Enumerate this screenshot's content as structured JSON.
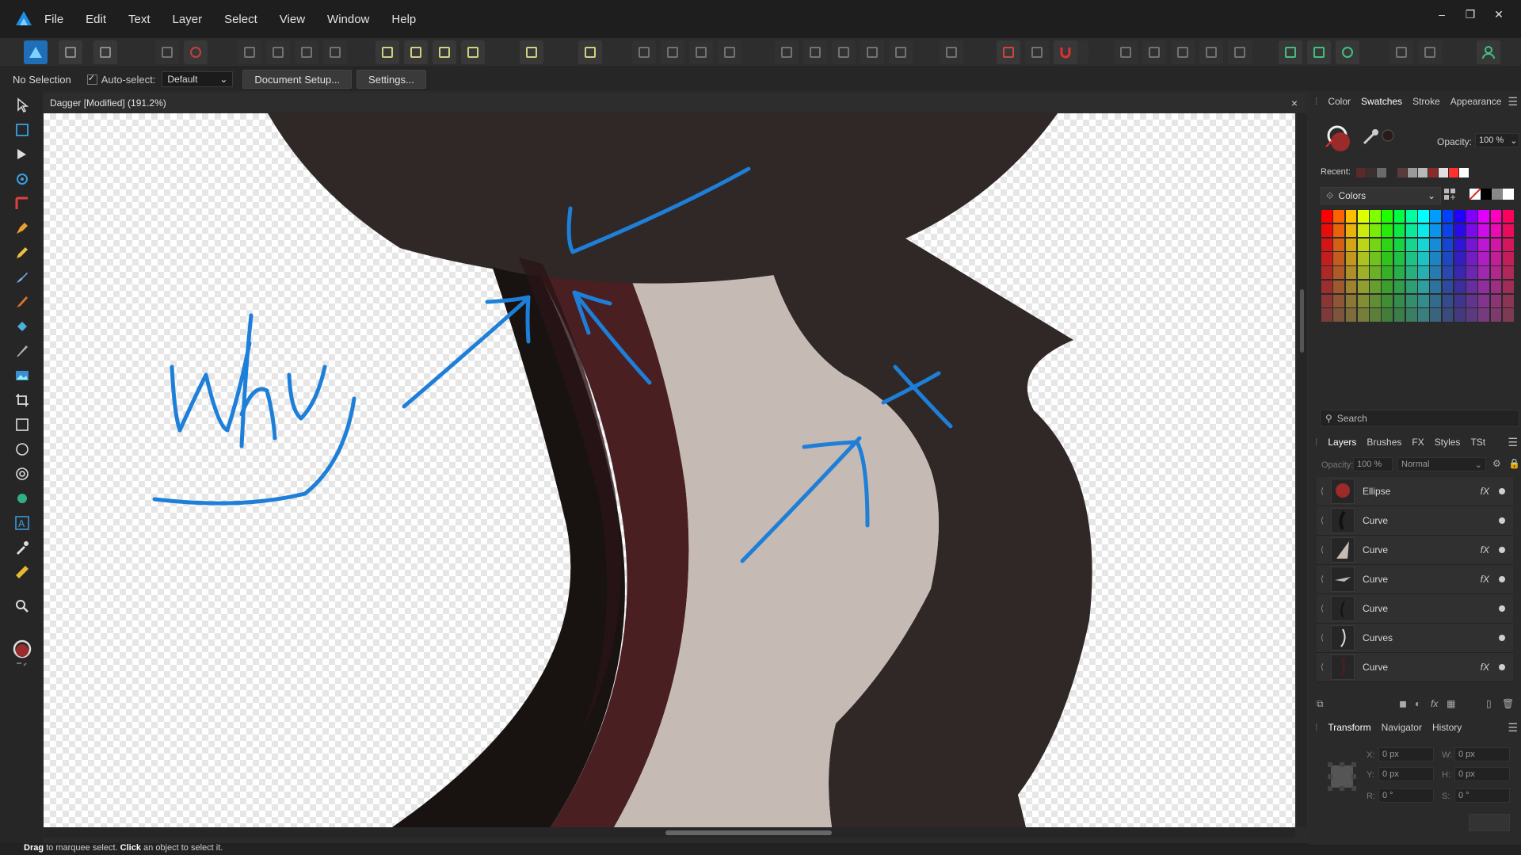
{
  "menu": [
    "File",
    "Edit",
    "Text",
    "Layer",
    "Select",
    "View",
    "Window",
    "Help"
  ],
  "window_controls": {
    "minimize": "–",
    "restore": "❐",
    "close": "✕"
  },
  "context": {
    "selection": "No Selection",
    "auto_select_label": "Auto-select:",
    "auto_select_value": "Default",
    "document_setup": "Document Setup...",
    "settings": "Settings..."
  },
  "document": {
    "title": "Dagger [Modified] (191.2%)",
    "close": "×"
  },
  "annotation_text": "why",
  "status": {
    "drag": "Drag",
    "drag_rest": " to marquee select. ",
    "click": "Click",
    "click_rest": " an object to select it."
  },
  "color_panel": {
    "tabs": [
      "Color",
      "Swatches",
      "Stroke",
      "Appearance"
    ],
    "active_tab": "Swatches",
    "opacity_label": "Opacity:",
    "opacity_value": "100 %",
    "recent_label": "Recent:",
    "palette": "Colors",
    "search_placeholder": "Search",
    "fill_color": "#9b2a2a",
    "recent_colors": [
      "#5a2a2a",
      "#3a3030",
      "#6a6a6a",
      "#2a2a2a",
      "#5a3a3a",
      "#9a9a9a",
      "#b8b8b8",
      "#8a2a2a",
      "#e0e0e0",
      "#ff3030",
      "#ffffff"
    ]
  },
  "layers_panel": {
    "tabs": [
      "Layers",
      "Brushes",
      "FX",
      "Styles",
      "TSt"
    ],
    "active_tab": "Layers",
    "opacity_label": "Opacity:",
    "opacity_value": "100 %",
    "blend_mode": "Normal",
    "layers": [
      {
        "name": "Ellipse",
        "fx": true
      },
      {
        "name": "Curve",
        "fx": false
      },
      {
        "name": "Curve",
        "fx": true
      },
      {
        "name": "Curve",
        "fx": true
      },
      {
        "name": "Curve",
        "fx": false
      },
      {
        "name": "Curves",
        "fx": false
      },
      {
        "name": "Curve",
        "fx": true
      }
    ],
    "fx_label": "fX"
  },
  "transform_panel": {
    "tabs": [
      "Transform",
      "Navigator",
      "History"
    ],
    "active_tab": "Transform",
    "x_label": "X:",
    "x": "0 px",
    "y_label": "Y:",
    "y": "0 px",
    "w_label": "W:",
    "w": "0 px",
    "h_label": "H:",
    "h": "0 px",
    "r_label": "R:",
    "r": "0 °",
    "s_label": "S:",
    "s": "0 °"
  },
  "colors": {
    "accent": "#1e7fd8",
    "dark_shape": "#2f2826",
    "maroon_shape": "#4a1f22",
    "light_shape": "#c5bab4",
    "black_shape": "#181311"
  }
}
